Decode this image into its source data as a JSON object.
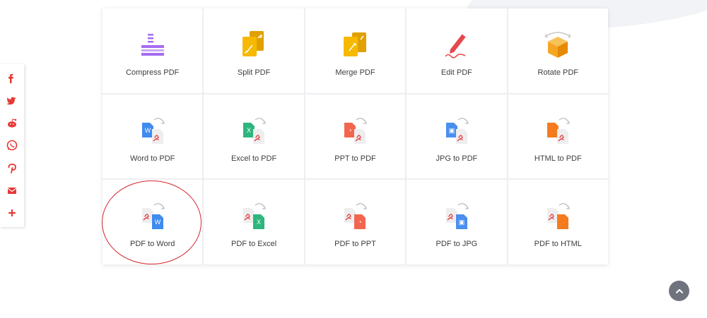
{
  "tools": [
    {
      "id": "compress-pdf",
      "label": "Compress PDF",
      "icon": "compress-icon"
    },
    {
      "id": "split-pdf",
      "label": "Split PDF",
      "icon": "split-icon"
    },
    {
      "id": "merge-pdf",
      "label": "Merge PDF",
      "icon": "merge-icon"
    },
    {
      "id": "edit-pdf",
      "label": "Edit PDF",
      "icon": "edit-pen-icon"
    },
    {
      "id": "rotate-pdf",
      "label": "Rotate PDF",
      "icon": "rotate-cube-icon"
    },
    {
      "id": "word-to-pdf",
      "label": "Word to PDF",
      "icon": "word-to-pdf-icon",
      "doc_letter": "W",
      "doc_color": "#3f8bef"
    },
    {
      "id": "excel-to-pdf",
      "label": "Excel to PDF",
      "icon": "excel-to-pdf-icon",
      "doc_letter": "X",
      "doc_color": "#2eb67d"
    },
    {
      "id": "ppt-to-pdf",
      "label": "PPT to PDF",
      "icon": "ppt-to-pdf-icon",
      "doc_letter": "◔",
      "doc_color": "#f2664f"
    },
    {
      "id": "jpg-to-pdf",
      "label": "JPG to PDF",
      "icon": "jpg-to-pdf-icon",
      "doc_letter": "▣",
      "doc_color": "#4a8ef0"
    },
    {
      "id": "html-to-pdf",
      "label": "HTML to PDF",
      "icon": "html-to-pdf-icon",
      "doc_letter": "</>",
      "doc_color": "#f57b1f"
    },
    {
      "id": "pdf-to-word",
      "label": "PDF to Word",
      "icon": "pdf-to-word-icon",
      "doc_letter": "W",
      "doc_color": "#3f8bef"
    },
    {
      "id": "pdf-to-excel",
      "label": "PDF to Excel",
      "icon": "pdf-to-excel-icon",
      "doc_letter": "X",
      "doc_color": "#2eb67d"
    },
    {
      "id": "pdf-to-ppt",
      "label": "PDF to PPT",
      "icon": "pdf-to-ppt-icon",
      "doc_letter": "◔",
      "doc_color": "#f2664f"
    },
    {
      "id": "pdf-to-jpg",
      "label": "PDF to JPG",
      "icon": "pdf-to-jpg-icon",
      "doc_letter": "▣",
      "doc_color": "#4a8ef0"
    },
    {
      "id": "pdf-to-html",
      "label": "PDF to HTML",
      "icon": "pdf-to-html-icon",
      "doc_letter": "</>",
      "doc_color": "#f57b1f"
    }
  ],
  "share_buttons": [
    {
      "id": "facebook",
      "icon": "facebook-icon",
      "glyph": "f"
    },
    {
      "id": "twitter",
      "icon": "twitter-icon",
      "glyph": "🐦"
    },
    {
      "id": "reddit",
      "icon": "reddit-icon",
      "glyph": "◉"
    },
    {
      "id": "whatsapp",
      "icon": "whatsapp-icon",
      "glyph": "☏"
    },
    {
      "id": "pinterest",
      "icon": "pinterest-icon",
      "glyph": "P"
    },
    {
      "id": "email",
      "icon": "email-icon",
      "glyph": "✉"
    },
    {
      "id": "more",
      "icon": "plus-icon",
      "glyph": "+"
    }
  ],
  "colors": {
    "accent": "#e53935",
    "pdf_red": "#e5484d",
    "doc_gray": "#eeeeee",
    "yellow": "#f6b900",
    "purple": "#a56cf0",
    "orange": "#f5a623",
    "highlight_ring": "#d6262c"
  },
  "highlighted_tool": "pdf-to-word",
  "back_to_top_icon": "chevron-up-icon"
}
